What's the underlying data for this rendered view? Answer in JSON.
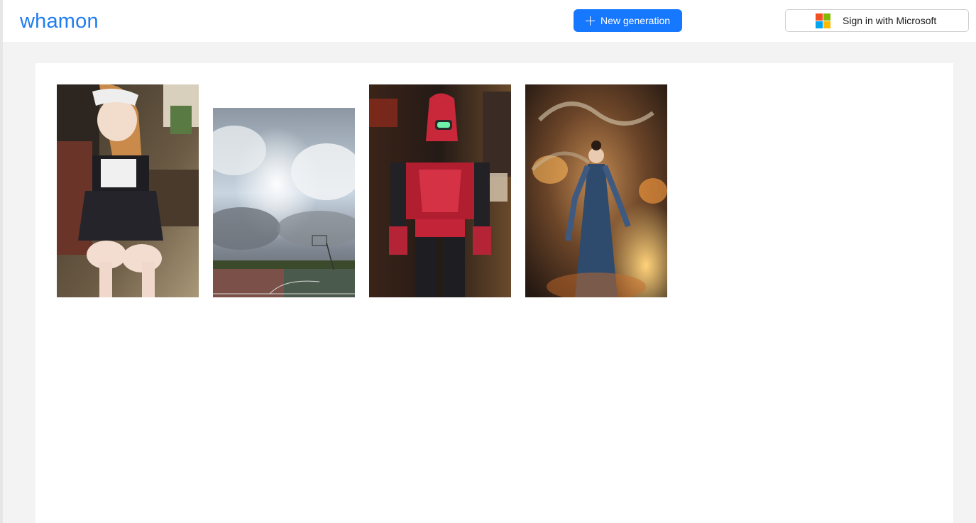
{
  "app": {
    "logo_text": "whamon"
  },
  "header": {
    "new_generation_label": "New generation",
    "sign_in_label": "Sign in with Microsoft",
    "brand_color": "#1677ff",
    "microsoft_logo_colors": [
      "#f25022",
      "#7fba00",
      "#00a4ef",
      "#ffb900"
    ]
  },
  "gallery": {
    "items": [
      {
        "icon": "anime-maid-image"
      },
      {
        "icon": "cloudy-sky-court-image"
      },
      {
        "icon": "red-armor-robot-image"
      },
      {
        "icon": "fire-spirit-woman-image"
      }
    ]
  }
}
